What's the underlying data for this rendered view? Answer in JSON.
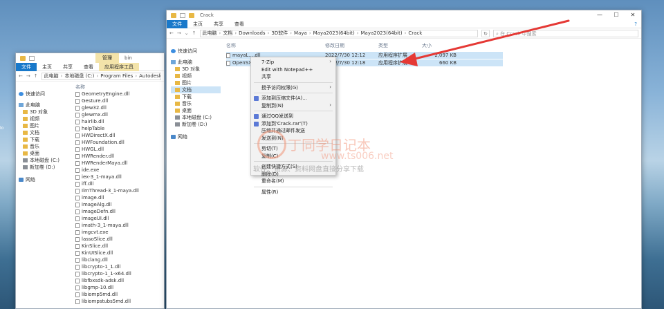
{
  "desktop": {
    "fragment": "lo"
  },
  "left_window": {
    "title": "bin",
    "context_tab": "管理",
    "ribbon_tabs": [
      "文件",
      "主页",
      "共享",
      "查看",
      "应用程序工具"
    ],
    "address": [
      "此电脑",
      "本地磁盘 (C:)",
      "Program Files",
      "Autodesk"
    ],
    "nav": [
      {
        "label": "快速访问",
        "icon": "star"
      },
      {
        "label": "此电脑",
        "icon": "pc"
      },
      {
        "label": "3D 对象",
        "icon": "folder"
      },
      {
        "label": "视频",
        "icon": "folder"
      },
      {
        "label": "图片",
        "icon": "folder"
      },
      {
        "label": "文档",
        "icon": "folder"
      },
      {
        "label": "下载",
        "icon": "folder"
      },
      {
        "label": "音乐",
        "icon": "folder"
      },
      {
        "label": "桌面",
        "icon": "folder"
      },
      {
        "label": "本地磁盘 (C:)",
        "icon": "drive"
      },
      {
        "label": "新加卷 (D:)",
        "icon": "drive"
      },
      {
        "label": "网络",
        "icon": "net"
      }
    ],
    "files_header": "名称",
    "files": [
      "GeometryEngine.dll",
      "Gesture.dll",
      "glew32.dll",
      "glewmx.dll",
      "hairlib.dll",
      "helpTable",
      "HWDirectX.dll",
      "HWFoundation.dll",
      "HWGL.dll",
      "HWRender.dll",
      "HWRenderMaya.dll",
      "ide.exe",
      "iex-3_1-maya.dll",
      "iff.dll",
      "IlmThread-3_1-maya.dll",
      "image.dll",
      "imageAlg.dll",
      "imageDefn.dll",
      "imageUI.dll",
      "imath-3_1-maya.dll",
      "imgcvt.exe",
      "lassoSlice.dll",
      "KinSlice.dll",
      "KinUISlice.dll",
      "libclang.dll",
      "libcrypto-1_1.dll",
      "libcrypto-1_1-x64.dll",
      "libfbxsdk-adsk.dll",
      "libgmp-10.dll",
      "libiomp5md.dll",
      "libiompstubs5md.dll"
    ]
  },
  "right_window": {
    "title": "Crack",
    "ribbon_tabs": [
      "文件",
      "主页",
      "共享",
      "查看"
    ],
    "address": [
      "此电脑",
      "文档",
      "Downloads",
      "3D软件",
      "Maya",
      "Maya2023(64bit)",
      "Maya2023(64bit)",
      "Crack"
    ],
    "search_placeholder": "在 Crack 中搜索",
    "nav": [
      {
        "label": "快速访问",
        "icon": "star"
      },
      {
        "label": "此电脑",
        "icon": "pc"
      },
      {
        "label": "3D 对象",
        "icon": "folder"
      },
      {
        "label": "视频",
        "icon": "folder"
      },
      {
        "label": "图片",
        "icon": "folder"
      },
      {
        "label": "文档",
        "icon": "folder",
        "selected": true
      },
      {
        "label": "下载",
        "icon": "folder"
      },
      {
        "label": "音乐",
        "icon": "folder"
      },
      {
        "label": "桌面",
        "icon": "folder"
      },
      {
        "label": "本地磁盘 (C:)",
        "icon": "drive"
      },
      {
        "label": "新加卷 (D:)",
        "icon": "drive"
      },
      {
        "label": "网络",
        "icon": "net"
      }
    ],
    "columns": [
      "名称",
      "修改日期",
      "类型",
      "大小"
    ],
    "files": [
      {
        "name": "mayaL....dll",
        "date": "2022/7/30 12:12",
        "type": "应用程序扩展",
        "size": "2,097 KB"
      },
      {
        "name": "OpenSXF....maya.dll",
        "date": "2022/7/30 12:18",
        "type": "应用程序扩展",
        "size": "660 KB"
      }
    ]
  },
  "context_menu": {
    "items": [
      {
        "label": "7-Zip",
        "arrow": true
      },
      {
        "label": "Edit with Notepad++"
      },
      {
        "label": "共享"
      },
      {
        "sep": true
      },
      {
        "label": "授予访问权限(G)",
        "arrow": true
      },
      {
        "sep": true
      },
      {
        "label": "添加到压缩文件(A)...",
        "icon": true
      },
      {
        "label": "复制到(N)",
        "arrow": true
      },
      {
        "sep": true
      },
      {
        "label": "通过QQ发送到",
        "icon": true
      },
      {
        "label": "添加到'Crack.rar'(T)",
        "icon": true
      },
      {
        "label": "压缩并通过邮件发送"
      },
      {
        "label": "发送到(N)"
      },
      {
        "sep": true
      },
      {
        "label": "剪切(T)"
      },
      {
        "label": "复制(C)"
      },
      {
        "sep": true
      },
      {
        "label": "创建快捷方式(S)"
      },
      {
        "label": "删除(D)"
      },
      {
        "label": "重命名(M)"
      },
      {
        "sep": true
      },
      {
        "label": "属性(R)"
      }
    ]
  },
  "watermark": {
    "title": "丁同学日记本",
    "url": "www.ts006.net",
    "subtitle": "软件、资源、资料网盘直接分享下载"
  },
  "colors": {
    "accent": "#1979ca",
    "selection": "#cce4f7",
    "arrow": "#e53935"
  }
}
